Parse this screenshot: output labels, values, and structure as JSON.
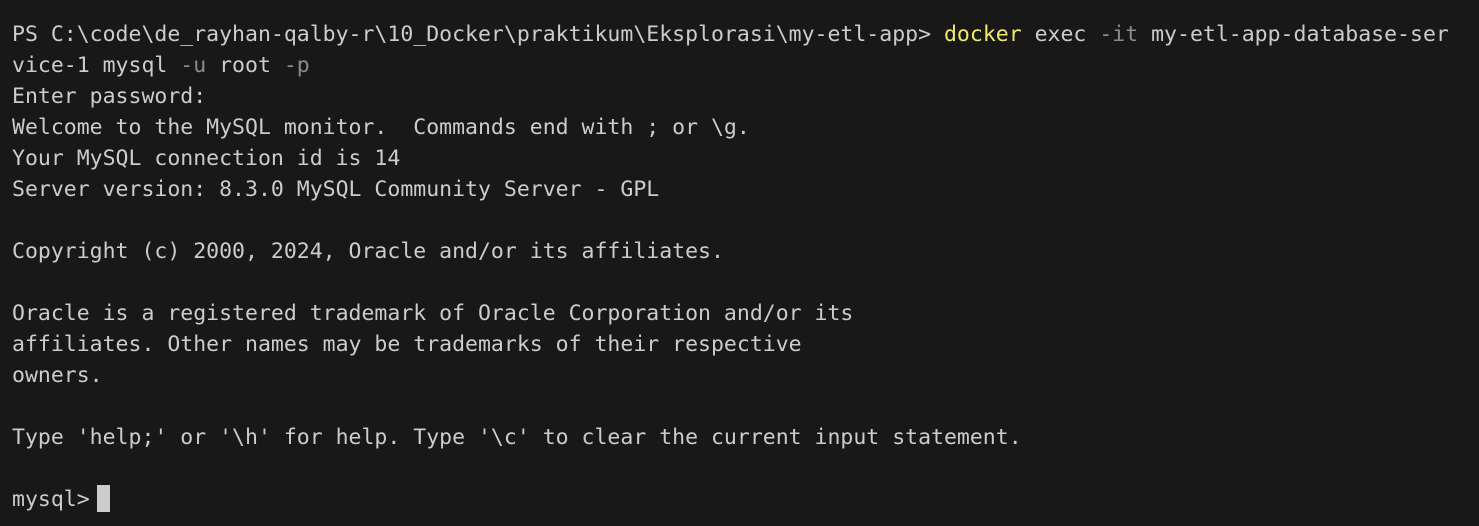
{
  "terminal": {
    "command": {
      "prompt": "PS C:\\code\\de_rayhan-qalby-r\\10_Docker\\praktikum\\Eksplorasi\\my-etl-app> ",
      "cmd": "docker",
      "s1": " exec ",
      "flag_it": "-it",
      "container_part1": " my-etl-app-database-ser",
      "container_part2": "vice-1",
      "mysql": " mysql ",
      "flag_u": "-u",
      "user": " root ",
      "flag_p": "-p"
    },
    "output": {
      "enter_password": "Enter password:",
      "welcome": "Welcome to the MySQL monitor.  Commands end with ; or \\g.",
      "connection_id": "Your MySQL connection id is 14",
      "server_version": "Server version: 8.3.0 MySQL Community Server - GPL",
      "copyright": "Copyright (c) 2000, 2024, Oracle and/or its affiliates.",
      "trademark_1": "Oracle is a registered trademark of Oracle Corporation and/or its",
      "trademark_2": "affiliates. Other names may be trademarks of their respective",
      "trademark_3": "owners.",
      "help": "Type 'help;' or '\\h' for help. Type '\\c' to clear the current input statement."
    },
    "mysql_prompt": "mysql>"
  },
  "colors": {
    "background": "#181818",
    "text": "#cccccc",
    "command": "#f0e96a",
    "flag": "#8b8b8b"
  }
}
